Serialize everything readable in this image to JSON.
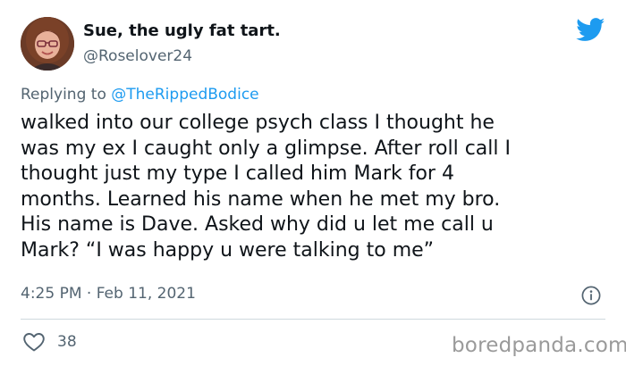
{
  "author": {
    "display_name": "Sue, the ugly fat tart.",
    "handle": "@Roselover24"
  },
  "reply": {
    "prefix": "Replying to",
    "to_handle": "@TheRippedBodice"
  },
  "tweet": {
    "lines": [
      "walked into our college psych class I thought he",
      "was my ex I caught only a glimpse. After roll call I",
      "thought just my type I called him Mark for 4",
      "months. Learned his name when he met my bro.",
      "His name is Dave. Asked why did u let me call u",
      "Mark? “I was happy u were talking to me”"
    ],
    "timestamp": "4:25 PM · Feb 11, 2021"
  },
  "stats": {
    "likes": "38"
  },
  "icons": {
    "brand": "twitter-bird-icon",
    "info": "info-icon",
    "like": "heart-icon"
  },
  "colors": {
    "twitter_blue": "#1d9bf0",
    "text": "#0f1419",
    "secondary": "#536471"
  },
  "watermark": "boredpanda.com"
}
